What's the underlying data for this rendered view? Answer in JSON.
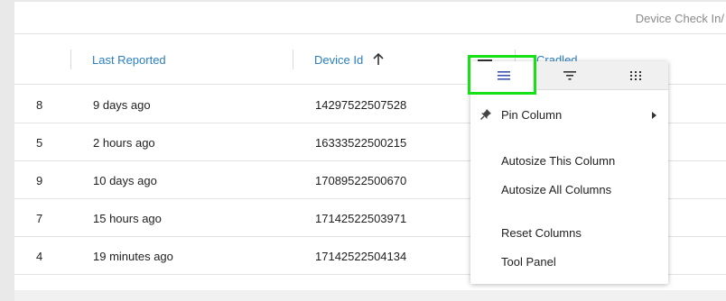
{
  "group_header": {
    "label": "Device Check In/"
  },
  "columns": [
    {
      "label": ""
    },
    {
      "label": "Last Reported"
    },
    {
      "label": "Device Id"
    },
    {
      "label": "Cradled"
    }
  ],
  "sort": {
    "column": "Device Id",
    "direction": "ascending",
    "icon": "arrow-up-icon"
  },
  "rows": [
    {
      "idx": "8",
      "reported": "9 days ago",
      "device": "14297522507528"
    },
    {
      "idx": "5",
      "reported": "2 hours ago",
      "device": "16333522500215"
    },
    {
      "idx": "9",
      "reported": "10 days ago",
      "device": "17089522500670"
    },
    {
      "idx": "7",
      "reported": "15 hours ago",
      "device": "17142522503971"
    },
    {
      "idx": "4",
      "reported": "19 minutes ago",
      "device": "17142522504134"
    }
  ],
  "column_menu": {
    "tabs": [
      {
        "icon": "menu-icon",
        "active": true
      },
      {
        "icon": "filter-icon",
        "active": false
      },
      {
        "icon": "grid-columns-icon",
        "active": false
      }
    ],
    "items": {
      "pin": "Pin Column",
      "autosize_this": "Autosize This Column",
      "autosize_all": "Autosize All Columns",
      "reset": "Reset Columns",
      "tool_panel": "Tool Panel"
    }
  },
  "colors": {
    "header_text": "#2a7fc0",
    "highlight": "#16e016",
    "active_tab_icon": "#3f51b5"
  }
}
